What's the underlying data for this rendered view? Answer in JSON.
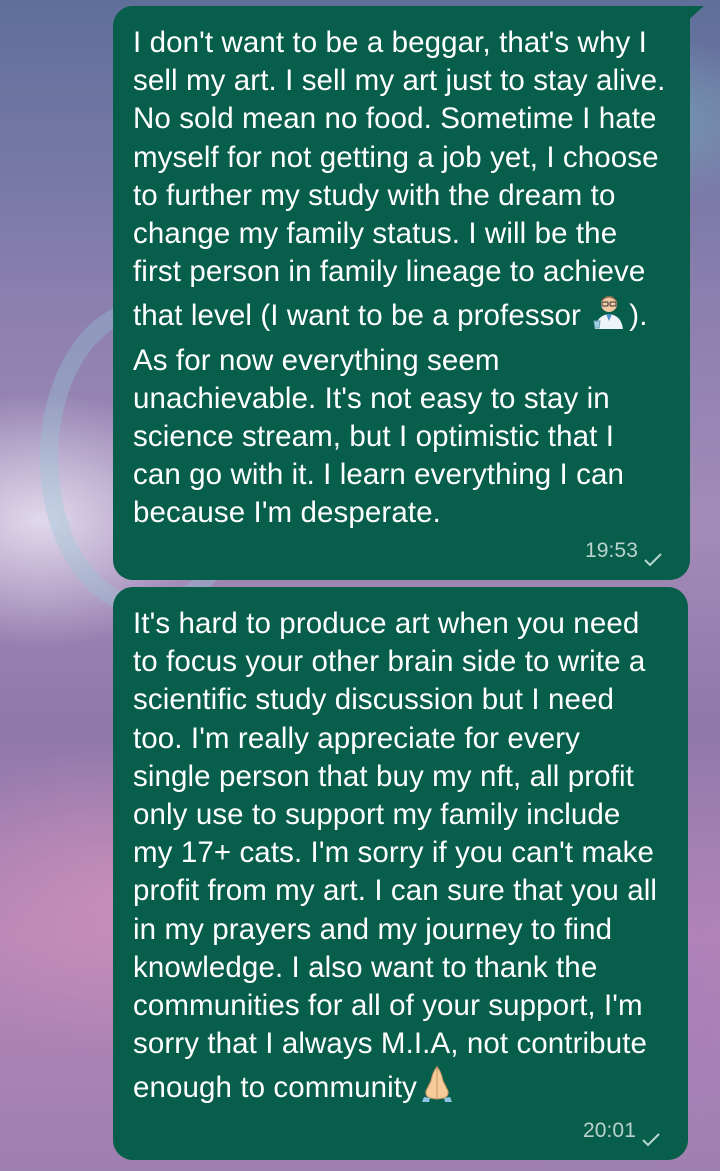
{
  "messages": [
    {
      "text_before_emoji": "I don't want to be a beggar, that's why I sell my art. I sell my art just to stay alive. No sold mean no food. Sometime I hate myself for not getting a job yet, I choose to further my study with the dream to change my family status. I will be the first person in family lineage to achieve that level (I want to be a professor ",
      "emoji": "scientist-emoji",
      "text_after_emoji": "). As for now everything seem unachievable. It's not easy to stay in science stream, but I optimistic that I can go with it. I learn everything I can because I'm desperate.",
      "time": "19:53",
      "status_icon": "check-icon"
    },
    {
      "text_before_emoji": "It's hard to produce art when you need to focus your other brain side to write a scientific study discussion but I need too. I'm really appreciate for every single person that buy my nft, all profit only use to support my family include my 17+ cats. I'm sorry if you can't make profit from my art. I can sure that you all in my prayers and my journey to find knowledge. I also want to thank the communities for all of your support, I'm sorry that I always M.I.A, not contribute enough to community",
      "emoji": "folded-hands-emoji",
      "text_after_emoji": "",
      "time": "20:01",
      "status_icon": "check-icon"
    }
  ],
  "colors": {
    "bubble": "#075e4b",
    "text": "#ffffff",
    "meta": "#b9d6cf"
  }
}
